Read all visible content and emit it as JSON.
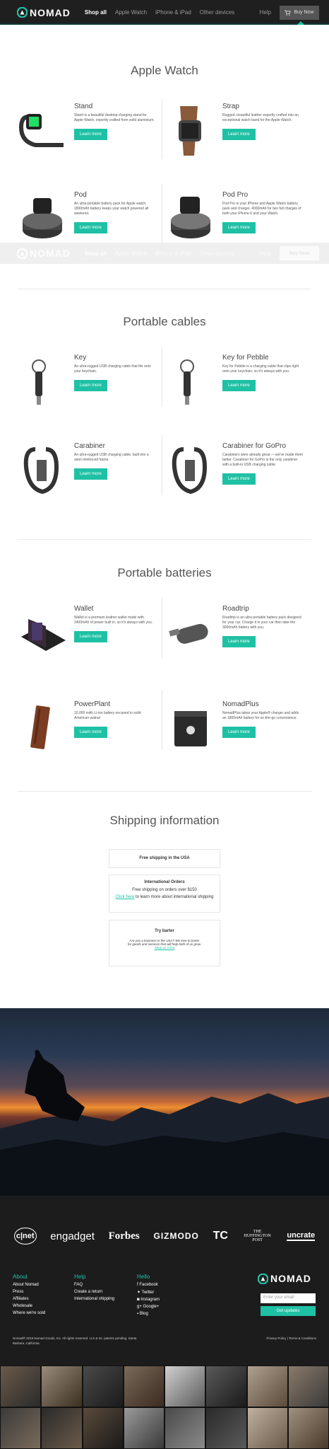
{
  "nav": {
    "brand": "NOMAD",
    "items": [
      "Shop all",
      "Apple Watch",
      "iPhone & iPad",
      "Other devices"
    ],
    "help": "Help",
    "buy": "Buy Now"
  },
  "sections": {
    "watch": "Apple Watch",
    "cables": "Portable cables",
    "batteries": "Portable batteries",
    "shipping": "Shipping information"
  },
  "button_label": "Learn more",
  "products": {
    "stand": {
      "name": "Stand",
      "desc": "Stand is a beautiful desktop charging stand for Apple Watch, expertly crafted from solid aluminium."
    },
    "strap": {
      "name": "Strap",
      "desc": "Rugged, beautiful leather expertly crafted into an exceptional watch band for the Apple Watch."
    },
    "pod": {
      "name": "Pod",
      "desc": "An ultra-portable battery pack for Apple watch. 1800mAh battery keeps your watch powered all weekend."
    },
    "podpro": {
      "name": "Pod Pro",
      "desc": "Pod Pro is your iPhone and Apple Watch battery pack and charger. 4000mAh for two full charges of both your iPhone 6 and your Watch."
    },
    "key": {
      "name": "Key",
      "desc": "An ultra-rugged USB charging cable that fits onto your keychain."
    },
    "keypebble": {
      "name": "Key for Pebble",
      "desc": "Key for Pebble is a charging cable that clips right onto your keychain, so it's always with you."
    },
    "carabiner": {
      "name": "Carabiner",
      "desc": "An ultra-rugged USB charging cable, built into a steel reinforced frame."
    },
    "carabinergopro": {
      "name": "Carabiner for GoPro",
      "desc": "Carabiners were already great — we've made them better. Carabiner for GoPro is the only carabiner with a built-in USB charging cable."
    },
    "wallet": {
      "name": "Wallet",
      "desc": "Wallet is a premium leather wallet made with 2400mAh of power built in, so it's always with you."
    },
    "roadtrip": {
      "name": "Roadtrip",
      "desc": "Roadtrip is an ultra portable battery pack designed for your car. Charge it in your car then take the 3000mAh battery with you."
    },
    "powerplant": {
      "name": "PowerPlant",
      "desc": "10,000 mAh Li-ion battery encased in solid American walnut"
    },
    "nomadplus": {
      "name": "NomadPlus",
      "desc": "NomadPlus takes your Apple® charger and adds an 1800mAh battery for on-the-go convenience."
    }
  },
  "shipping": {
    "usa": "Free shipping in the USA",
    "intl_title": "International Orders",
    "intl_line": "Free shipping on orders over $150",
    "intl_link": "Click here",
    "intl_rest": " to learn more about international shipping",
    "barter_title": "Try barter",
    "barter_line1": "Are you a business in the USA? We love to barter",
    "barter_line2": "for goods and services that will help both of us grow.",
    "barter_link": "Shop us a line"
  },
  "press": [
    "c|net",
    "engadget",
    "Forbes",
    "GIZMODO",
    "TC",
    "THE HUFFINGTON POST",
    "uncrate"
  ],
  "footer": {
    "about_title": "About",
    "about": [
      "About Nomad",
      "Press",
      "Affiliates",
      "Wholesale",
      "Where we're sold"
    ],
    "help_title": "Help",
    "help": [
      "FAQ",
      "Create a return",
      "International shipping"
    ],
    "hello_title": "Hello",
    "hello": [
      "Facebook",
      "Twitter",
      "Instagram",
      "Google+",
      "Blog"
    ],
    "email_placeholder": "Enter your email",
    "signup": "Get updates",
    "legal": "Nomad® 2016 Nomad Goods, Inc. All rights reserved. U.S & Int. patents pending. Santa Barbara, California.",
    "policy": "Privacy Policy | Terms & Conditions"
  }
}
